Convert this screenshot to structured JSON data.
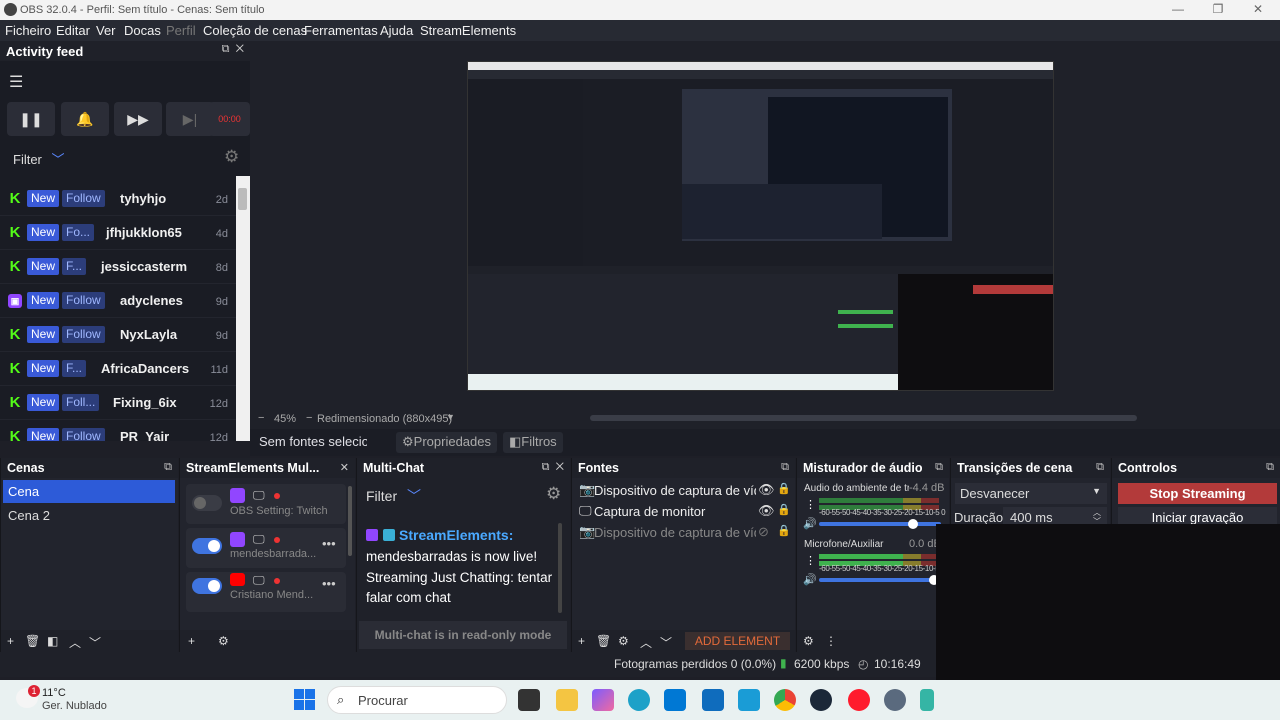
{
  "window": {
    "title": "OBS 32.0.4 - Perfil: Sem título - Cenas: Sem título"
  },
  "menu": [
    "Ficheiro",
    "Editar",
    "Ver",
    "Docas",
    "Perfil",
    "Coleção de cenas",
    "Ferramentas",
    "Ajuda",
    "StreamElements"
  ],
  "activity_feed": {
    "title": "Activity feed",
    "timer": "00:00",
    "filter_label": "Filter",
    "new_label": "New",
    "items": [
      {
        "platform": "kick",
        "follow": "Follow",
        "user": "tyhyhjo",
        "age": "2d"
      },
      {
        "platform": "kick",
        "follow": "Fo...",
        "user": "jfhjukklon65",
        "age": "4d"
      },
      {
        "platform": "kick",
        "follow": "F...",
        "user": "jessiccasterm",
        "age": "8d"
      },
      {
        "platform": "twitch",
        "follow": "Follow",
        "user": "adyclenes",
        "age": "9d"
      },
      {
        "platform": "kick",
        "follow": "Follow",
        "user": "NyxLayla",
        "age": "9d"
      },
      {
        "platform": "kick",
        "follow": "F...",
        "user": "AfricaDancers",
        "age": "11d"
      },
      {
        "platform": "kick",
        "follow": "Foll...",
        "user": "Fixing_6ix",
        "age": "12d"
      },
      {
        "platform": "kick",
        "follow": "Follow",
        "user": "PR_Yair",
        "age": "12d"
      }
    ]
  },
  "preview": {
    "zoom": "45%",
    "resize_text": "Redimensionado (880x495)",
    "no_source": "Sem fontes selecionadas",
    "properties": "Propriedades",
    "filters": "Filtros"
  },
  "scenes": {
    "title": "Cenas",
    "items": [
      "Cena",
      "Cena 2"
    ]
  },
  "se_multistream": {
    "title": "StreamElements Mul...",
    "items": [
      {
        "label": "OBS Setting: Twitch",
        "enabled": false,
        "platform": "twitch"
      },
      {
        "label": "mendesbarrada...",
        "enabled": true,
        "platform": "twitch"
      },
      {
        "label": "Cristiano Mend...",
        "enabled": true,
        "platform": "youtube"
      }
    ]
  },
  "multichat": {
    "title": "Multi-Chat",
    "filter_label": "Filter",
    "sender": "StreamElements:",
    "message": "mendesbarradas is now live! Streaming Just Chatting: tentar falar com chat",
    "readonly": "Multi-chat is in read-only mode"
  },
  "sources": {
    "title": "Fontes",
    "items": [
      {
        "label": "Dispositivo de captura de vídeo",
        "icon": "camera-icon",
        "visible": true
      },
      {
        "label": "Captura de monitor",
        "icon": "monitor-icon",
        "visible": true
      },
      {
        "label": "Dispositivo de captura de vídeo",
        "icon": "camera-icon",
        "visible": false
      }
    ],
    "add_element": "ADD ELEMENT"
  },
  "mixer": {
    "title": "Misturador de áudio",
    "channels": [
      {
        "name": "Áudio do ambiente de tra",
        "db": "-4.4 dB",
        "level": 0.85
      },
      {
        "name": "Microfone/Auxiliar",
        "db": "0.0 dB",
        "level": 0.95
      }
    ],
    "scale": "-60-55-50-45-40-35-30-25-20-15-10-5 0"
  },
  "transitions": {
    "title": "Transições de cena",
    "selected": "Desvanecer",
    "duration_label": "Duração",
    "duration_value": "400 ms"
  },
  "controls": {
    "title": "Controlos",
    "stop_streaming": "Stop Streaming",
    "start_recording": "Iniciar gravação"
  },
  "status": {
    "dropped_frames": "Fotogramas perdidos 0 (0.0%)",
    "bitrate": "6200 kbps",
    "time": "10:16:49"
  },
  "taskbar": {
    "weather_temp": "11°C",
    "weather_desc": "Ger. Nublado",
    "notification_count": "1",
    "search_placeholder": "Procurar"
  },
  "colors": {
    "accent": "#3a5ad8",
    "stop": "#b33a3a",
    "kick": "#53fc18",
    "twitch": "#9146ff",
    "youtube": "#ff0000"
  }
}
